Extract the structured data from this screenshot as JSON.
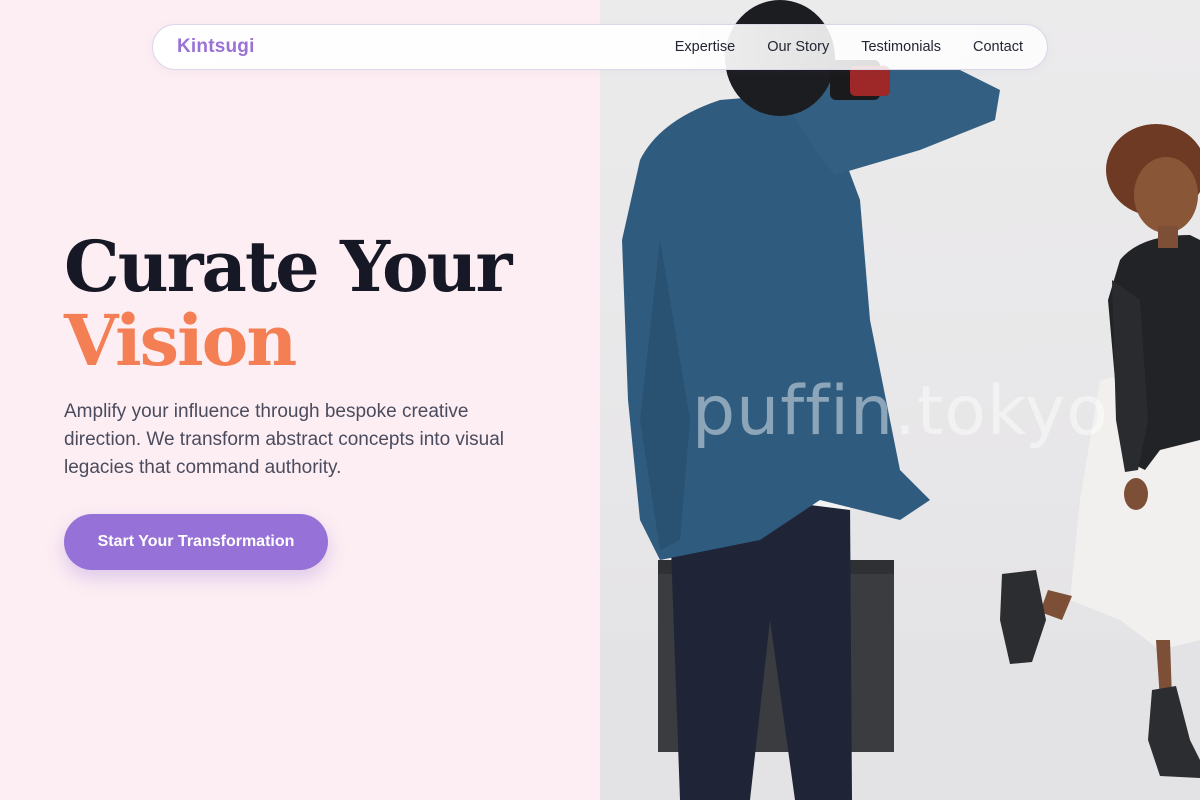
{
  "brand": {
    "name": "Kintsugi"
  },
  "nav": {
    "links": [
      "Expertise",
      "Our Story",
      "Testimonials",
      "Contact"
    ]
  },
  "hero": {
    "title_line1": "Curate Your",
    "title_line2": "Vision",
    "subtitle": "Amplify your influence through bespoke creative direction. We transform abstract concepts into visual legacies that command authority.",
    "cta_label": "Start Your Transformation"
  },
  "image": {
    "watermark": "puffin.tokyo",
    "description_icon": "photographer-photo"
  },
  "colors": {
    "background": "#fdeef3",
    "brand": "#9a72d6",
    "title_dark": "#161826",
    "title_accent": "#f47f55",
    "body_text": "#4a4c5e",
    "cta_bg": "#9672d8",
    "cta_text": "#ffffff"
  }
}
